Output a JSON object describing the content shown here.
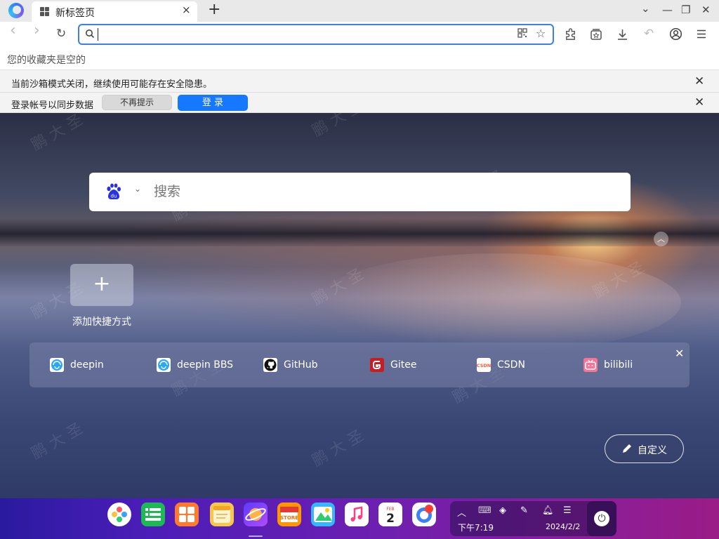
{
  "tab": {
    "title": "新标签页",
    "close_icon": "×"
  },
  "newtab_icon": "+",
  "window": {
    "dropdown": "⌄",
    "minimize": "—",
    "restore": "❐",
    "close": "✕"
  },
  "toolbar": {
    "back_icon": "‹",
    "forward_icon": "›",
    "reload_icon": "↻",
    "omnibox": {
      "value": "",
      "placeholder": ""
    },
    "extensions_icon": "puzzle-icon",
    "collections_icon": "collections-icon",
    "download_icon": "↓",
    "undo_icon": "↶",
    "profile_icon": "◯",
    "menu_icon": "☰"
  },
  "bookmarks": {
    "empty_text": "您的收藏夹是空的"
  },
  "infobars": {
    "sandbox": {
      "text": "当前沙箱模式关闭，继续使用可能存在安全隐患。"
    },
    "sync": {
      "text": "登录帐号以同步数据",
      "dismiss_label": "不再提示",
      "login_label": "登 录"
    }
  },
  "newtab": {
    "search": {
      "engine": "baidu",
      "placeholder": "搜索",
      "caret": "⌄"
    },
    "collapse_icon": "︿",
    "add_shortcut": {
      "icon": "+",
      "label": "添加快捷方式"
    },
    "sites": [
      {
        "label": "deepin",
        "icon": "deepin-icon",
        "color": "#2ca7f8"
      },
      {
        "label": "deepin BBS",
        "icon": "deepin-bbs-icon",
        "color": "#2ca7f8"
      },
      {
        "label": "GitHub",
        "icon": "github-icon",
        "color": "#111111"
      },
      {
        "label": "Gitee",
        "icon": "gitee-icon",
        "color": "#c71d23"
      },
      {
        "label": "CSDN",
        "icon": "csdn-icon",
        "color": "#fc5531"
      },
      {
        "label": "bilibili",
        "icon": "bilibili-icon",
        "color": "#fb7299"
      }
    ],
    "sites_close": "✕",
    "customize_label": "自定义"
  },
  "dock": {
    "apps": [
      {
        "name": "launcher",
        "color": "#ffffff"
      },
      {
        "name": "terminal",
        "color": "#1db954"
      },
      {
        "name": "multitask",
        "color": "#ff7a2f"
      },
      {
        "name": "notes",
        "color": "#f5c84c"
      },
      {
        "name": "browser",
        "color": "#7e57ff"
      },
      {
        "name": "app-store",
        "color": "#ff9800"
      },
      {
        "name": "gallery",
        "color": "#35b6ff"
      },
      {
        "name": "music",
        "color": "#ff4d8d"
      },
      {
        "name": "calendar",
        "color": "#ffffff"
      },
      {
        "name": "browser-2",
        "color": "#3b82f6"
      }
    ],
    "calendar": {
      "month": "FEB",
      "day": "2"
    },
    "tray": {
      "time": "下午7:19",
      "date": "2024/2/2"
    }
  },
  "colors": {
    "accent": "#1677ff",
    "omnibox_border": "#3b7ff0",
    "dock_start": "#2a1aa0",
    "dock_end": "#9a1c86"
  }
}
